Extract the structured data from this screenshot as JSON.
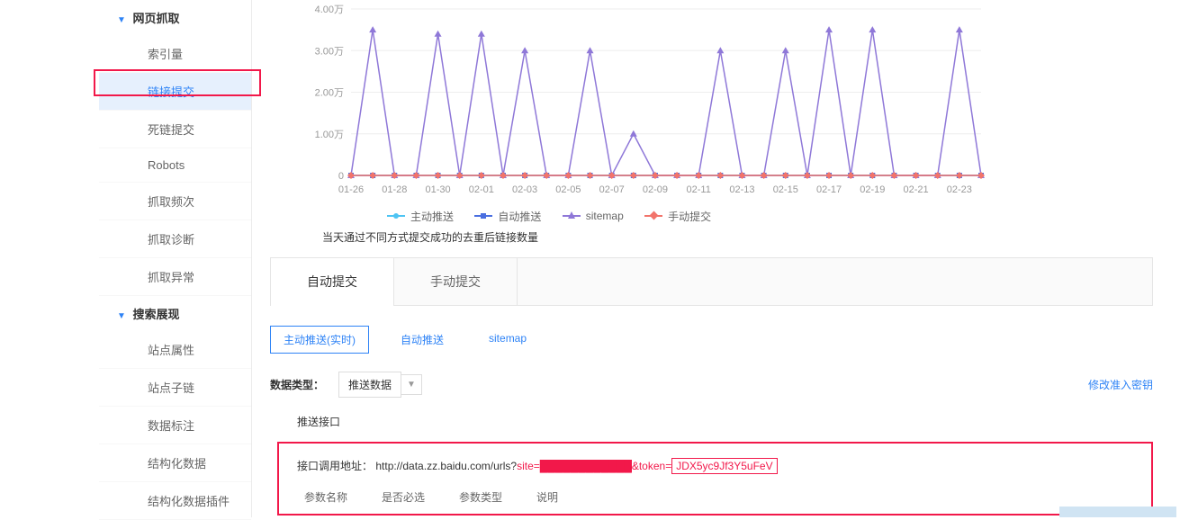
{
  "sidebar": {
    "sections": [
      {
        "title": "网页抓取",
        "items": [
          "索引量",
          "链接提交",
          "死链提交",
          "Robots",
          "抓取频次",
          "抓取诊断",
          "抓取异常"
        ]
      },
      {
        "title": "搜索展现",
        "items": [
          "站点属性",
          "站点子链",
          "数据标注",
          "结构化数据",
          "结构化数据插件"
        ]
      }
    ],
    "activeItem": "链接提交"
  },
  "chart_data": {
    "type": "line",
    "title": "",
    "xlabel": "",
    "ylabel": "",
    "ylim": [
      0,
      40000
    ],
    "y_ticks": [
      "0",
      "1.00万",
      "2.00万",
      "3.00万",
      "4.00万"
    ],
    "categories": [
      "01-26",
      "01-27",
      "01-28",
      "01-29",
      "01-30",
      "01-31",
      "02-01",
      "02-02",
      "02-03",
      "02-04",
      "02-05",
      "02-06",
      "02-07",
      "02-08",
      "02-09",
      "02-10",
      "02-11",
      "02-12",
      "02-13",
      "02-14",
      "02-15",
      "02-16",
      "02-17",
      "02-18",
      "02-19",
      "02-20",
      "02-21",
      "02-22",
      "02-23",
      "02-24"
    ],
    "x_tick_labels": [
      "01-26",
      "01-28",
      "01-30",
      "02-01",
      "02-03",
      "02-05",
      "02-07",
      "02-09",
      "02-11",
      "02-13",
      "02-15",
      "02-17",
      "02-19",
      "02-21",
      "02-23"
    ],
    "series": [
      {
        "name": "主动推送",
        "color": "#4ec4f3",
        "values": [
          0,
          0,
          0,
          0,
          0,
          0,
          0,
          0,
          0,
          0,
          0,
          0,
          0,
          0,
          0,
          0,
          0,
          0,
          0,
          0,
          0,
          0,
          0,
          0,
          0,
          0,
          0,
          0,
          0,
          0
        ]
      },
      {
        "name": "自动推送",
        "color": "#4a6fe0",
        "values": [
          0,
          0,
          0,
          0,
          0,
          0,
          0,
          0,
          0,
          0,
          0,
          0,
          0,
          0,
          0,
          0,
          0,
          0,
          0,
          0,
          0,
          0,
          0,
          0,
          0,
          0,
          0,
          0,
          0,
          0
        ]
      },
      {
        "name": "sitemap",
        "color": "#8f78d8",
        "values": [
          0,
          35000,
          0,
          0,
          34000,
          0,
          34000,
          0,
          30000,
          0,
          0,
          30000,
          0,
          10000,
          0,
          0,
          0,
          30000,
          0,
          0,
          30000,
          0,
          35000,
          0,
          35000,
          0,
          0,
          0,
          35000,
          0
        ]
      },
      {
        "name": "手动提交",
        "color": "#f2746b",
        "values": [
          0,
          0,
          0,
          0,
          0,
          0,
          0,
          0,
          0,
          0,
          0,
          0,
          0,
          0,
          0,
          0,
          0,
          0,
          0,
          0,
          0,
          0,
          0,
          0,
          0,
          0,
          0,
          0,
          0,
          0
        ]
      }
    ],
    "description": "当天通过不同方式提交成功的去重后链接数量"
  },
  "tabs": {
    "auto": "自动提交",
    "manual": "手动提交"
  },
  "subTabs": {
    "active_push": "主动推送(实时)",
    "auto_push": "自动推送",
    "sitemap": "sitemap"
  },
  "form": {
    "data_type_label": "数据类型：",
    "data_type_value": "推送数据",
    "modify_key": "修改准入密钥",
    "push_interface": "推送接口",
    "api_label": "接口调用地址：",
    "api_url_prefix": "http://data.zz.baidu.com/urls?",
    "api_site_param": "site=",
    "api_site_value_masked": "████████████",
    "api_token_param": "&token=",
    "api_token_value": "JDX5yc9Jf3Y5uFeV"
  },
  "paramHeaders": [
    "参数名称",
    "是否必选",
    "参数类型",
    "说明"
  ]
}
